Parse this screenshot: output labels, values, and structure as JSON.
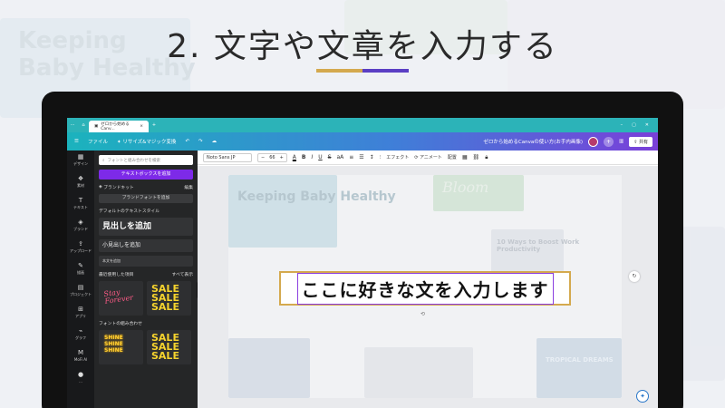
{
  "heading": {
    "title": "2. 文字や文章を入力する"
  },
  "background": {
    "left_text": "Keeping Baby Healthy"
  },
  "browser": {
    "tab_title": "ゼロから始めるCanv...",
    "tab_close": "×",
    "new_tab": "+"
  },
  "canva_header": {
    "file_label": "ファイル",
    "resize_label": "リサイズ&マジック変換",
    "doc_title": "ゼロから始めるCanvaの使い方(お手内画像)",
    "share_label": "共有"
  },
  "rail": {
    "items": [
      {
        "icon": "design-icon",
        "glyph": "▦",
        "label": "デザイン"
      },
      {
        "icon": "elements-icon",
        "glyph": "❖",
        "label": "素材"
      },
      {
        "icon": "text-icon",
        "glyph": "T",
        "label": "テキスト"
      },
      {
        "icon": "brand-icon",
        "glyph": "◈",
        "label": "ブランド"
      },
      {
        "icon": "upload-icon",
        "glyph": "⇪",
        "label": "アップロード"
      },
      {
        "icon": "draw-icon",
        "glyph": "✎",
        "label": "描画"
      },
      {
        "icon": "projects-icon",
        "glyph": "▤",
        "label": "プロジェクト"
      },
      {
        "icon": "apps-icon",
        "glyph": "⊞",
        "label": "アプリ"
      },
      {
        "icon": "charts-icon",
        "glyph": "⌁",
        "label": "グラフ"
      },
      {
        "icon": "mofi-icon",
        "glyph": "M",
        "label": "MoFi Al"
      },
      {
        "icon": "profile-icon",
        "glyph": "●",
        "label": "..."
      }
    ]
  },
  "panel": {
    "search_placeholder": "フォントと組み合わせを検索",
    "add_textbox": "テキストボックスを追加",
    "brand_kit": "ブランドキット",
    "edit": "編集",
    "add_brand_font": "ブランドフォントを追加",
    "default_styles": "デフォルトのテキストスタイル",
    "add_heading": "見出しを追加",
    "add_subheading": "小見出しを追加",
    "add_body": "本文を追加",
    "recent": "最近使用した項目",
    "see_all": "すべて表示",
    "font_combos": "フォントの組み合わせ",
    "combo_script": "Stay Forever",
    "combo_sale": "SALE SALE SALE",
    "combo_shine": "SHINE SHINE SHINE"
  },
  "toolbar": {
    "font": "Noto Sans JP",
    "minus": "−",
    "size": "66",
    "plus": "+",
    "effects": "エフェクト",
    "animate": "アニメート",
    "position": "配置"
  },
  "canvas": {
    "main_text": "ここに好きな文を入力します",
    "bloom": "Bloom",
    "ways_text": "10 Ways to Boost Work Productivity",
    "tropical": "TROPICAL DREAMS"
  },
  "colors": {
    "accent_gold": "#d4a94e",
    "accent_purple": "#5b3fc4",
    "canva_purple": "#7d2ae8",
    "canva_teal": "#1bb3bd"
  }
}
